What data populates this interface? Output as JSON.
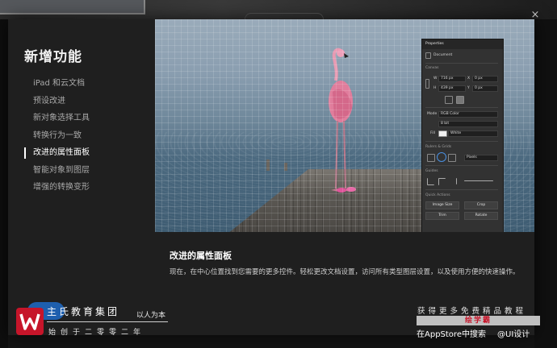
{
  "dialog": {
    "title": "新增功能",
    "close_label": "×",
    "nav_items": [
      {
        "label": "iPad 和云文档",
        "active": false
      },
      {
        "label": "预设改进",
        "active": false
      },
      {
        "label": "新对象选择工具",
        "active": false
      },
      {
        "label": "转换行为一致",
        "active": false
      },
      {
        "label": "改进的属性面板",
        "active": true
      },
      {
        "label": "智能对象到图层",
        "active": false
      },
      {
        "label": "增强的转换变形",
        "active": false
      }
    ],
    "feature": {
      "title": "改进的属性面板",
      "description": "现在，在中心位置找到您需要的更多控件。轻松更改文档设置，访问所有类型图层设置，以及使用方便的快速操作。"
    }
  },
  "properties_panel": {
    "title": "Properties",
    "doc_label": "Document",
    "canvas_label": "Canvas",
    "width_label": "W",
    "width_value": "716 px",
    "x_label": "X",
    "x_value": "0 px",
    "height_label": "H",
    "height_value": "439 px",
    "y_label": "Y",
    "y_value": "0 px",
    "mode_label": "Mode",
    "mode_value": "RGB Color",
    "bit_value": "8 bit",
    "fill_label": "Fill",
    "fill_value": "White",
    "rulers_label": "Rulers & Grids",
    "units_value": "Pixels",
    "guides_label": "Guides",
    "quick_actions_label": "Quick Actions",
    "btn_image_size": "Image Size",
    "btn_crop": "Crop",
    "btn_trim": "Trim",
    "btn_rotate": "Rotate"
  },
  "watermark": {
    "left_main": "氏教育集团",
    "left_main_prefix": "主",
    "left_slogan": "以人为本",
    "left_sub": "始创于二零零二年",
    "right_line1": "获得更多免费精品教程",
    "right_line2": "绘学霸",
    "right_line3": "在AppStore中搜索",
    "weibo": "@UI设计"
  }
}
